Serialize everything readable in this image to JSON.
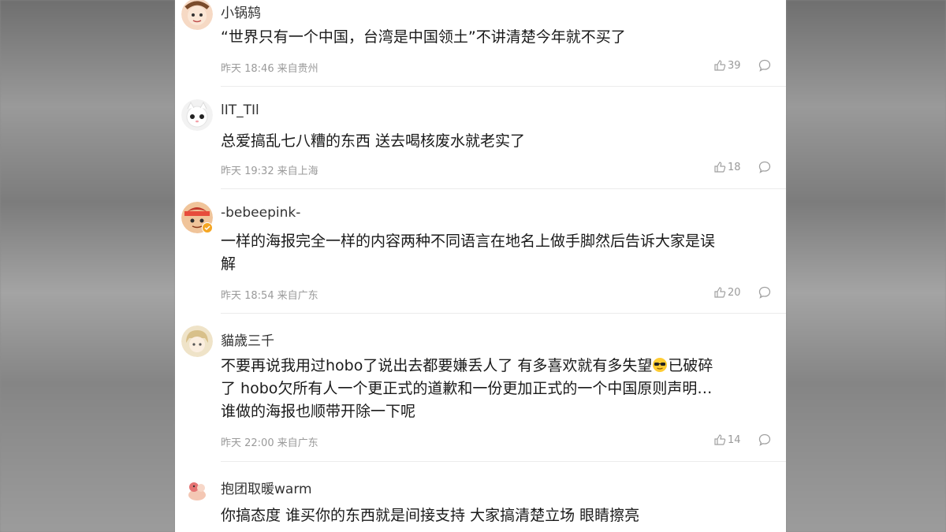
{
  "comments": [
    {
      "username": "小锅鸫",
      "text": "“世界只有一个中国，台湾是中国领土”不讲清楚今年就不买了",
      "time": "昨天 18:46",
      "location": "来自贵州",
      "likes": "39",
      "avatar": "avatar-cartoon-face"
    },
    {
      "username": "lIT_TIl",
      "text": "总爱搞乱七八糟的东西 送去喝核废水就老实了",
      "time": "昨天 19:32",
      "location": "来自上海",
      "likes": "18",
      "avatar": "avatar-white-cat"
    },
    {
      "username": "-bebeepink-",
      "text_line1": "一样的海报完全一样的内容两种不同语言在地名上做手脚然后告诉大家是误",
      "text_line2": "解",
      "time": "昨天 18:54",
      "location": "来自广东",
      "likes": "20",
      "avatar": "avatar-cartoon-boy",
      "badge": "verified-badge"
    },
    {
      "username": "貓歳三千",
      "text_line1a": "不要再说我用过hobo了说出去都要嫌丢人了 有多喜欢就有多失望",
      "emoji": "sunglasses-emoji",
      "text_line1b": "已破碎",
      "text_line2": "了 hobo欠所有人一个更正式的道歉和一份更加正式的一个中国原则声明…",
      "text_line3": "谁做的海报也顺带开除一下呢",
      "time": "昨天 22:00",
      "location": "来自广东",
      "likes": "14",
      "avatar": "avatar-anime-girl"
    },
    {
      "username": "抱团取暖warm",
      "text": "你搞态度 谁买你的东西就是间接支持 大家搞清楚立场 眼睛擦亮",
      "avatar": "avatar-small-figure"
    }
  ],
  "colors": {
    "background": "#8a8a8a",
    "panel": "#ffffff",
    "text": "#1a1a1a",
    "meta": "#9a9a9a"
  }
}
